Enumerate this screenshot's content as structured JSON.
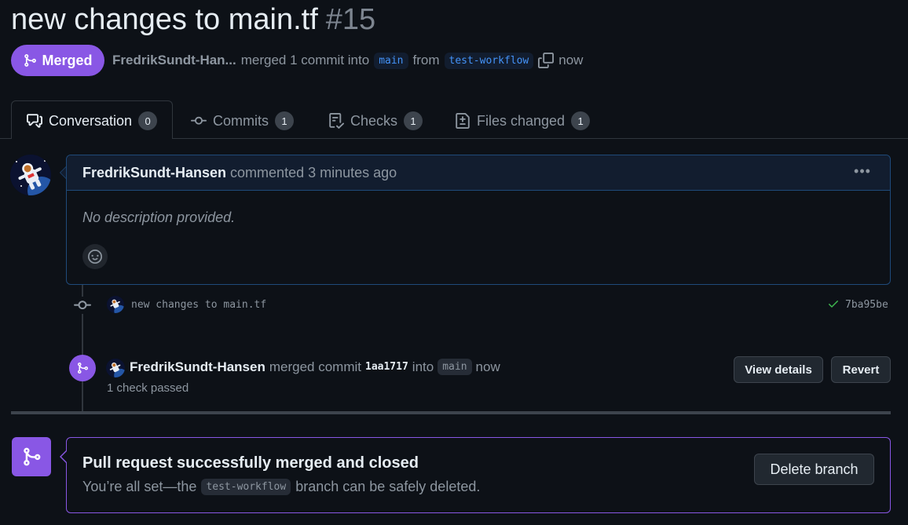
{
  "pr": {
    "title": "new changes to main.tf",
    "number": "#15",
    "state_label": "Merged",
    "author_short": "FredrikSundt-Han...",
    "merged_phrase": "merged 1 commit into",
    "base_branch": "main",
    "from_word": "from",
    "head_branch": "test-workflow",
    "when": "now"
  },
  "tabs": [
    {
      "label": "Conversation",
      "count": "0"
    },
    {
      "label": "Commits",
      "count": "1"
    },
    {
      "label": "Checks",
      "count": "1"
    },
    {
      "label": "Files changed",
      "count": "1"
    }
  ],
  "comment": {
    "author": "FredrikSundt-Hansen",
    "action": "commented",
    "time": "3 minutes ago",
    "body": "No description provided."
  },
  "timeline": {
    "commit_message": "new changes to main.tf",
    "commit_sha": "7ba95be",
    "merge_author": "FredrikSundt-Hansen",
    "merge_action": "merged commit",
    "merge_sha": "1aa1717",
    "into_word": "into",
    "merge_branch": "main",
    "merge_when": "now",
    "checks_text": "1 check passed",
    "view_details_label": "View details",
    "revert_label": "Revert"
  },
  "merged_box": {
    "title": "Pull request successfully merged and closed",
    "sub_before": "You’re all set—the",
    "branch": "test-workflow",
    "sub_after": "branch can be safely deleted.",
    "delete_label": "Delete branch"
  },
  "colors": {
    "accent_purple": "#8957e5",
    "background": "#0d1117",
    "link_blue": "#4493f8",
    "success_green": "#3fb950"
  }
}
